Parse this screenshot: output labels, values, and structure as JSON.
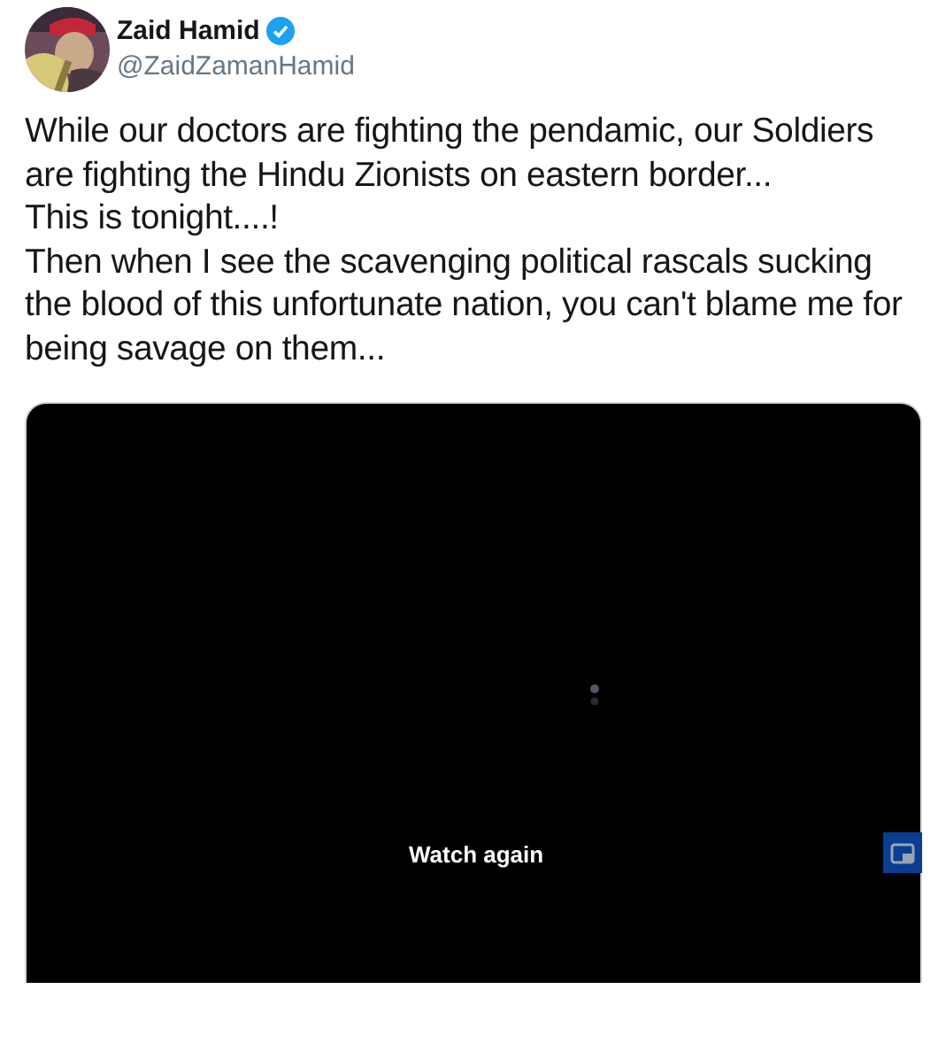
{
  "author": {
    "name": "Zaid Hamid",
    "verified": true,
    "handle": "@ZaidZamanHamid"
  },
  "text": "While our doctors are fighting the pendamic, our Soldiers are fighting the Hindu Zionists on eastern border...\nThis is tonight....!\nThen when I see the scavenging political rascals sucking the blood of this unfortunate nation, you can't blame me for being savage on them...",
  "video": {
    "action": "Watch again"
  }
}
